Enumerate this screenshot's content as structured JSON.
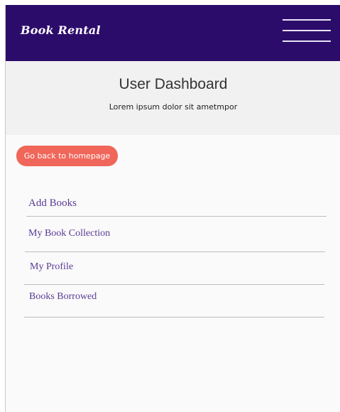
{
  "navbar": {
    "brand": "Book Rental",
    "menu_icon": "hamburger-menu-icon",
    "background_color": "#2c0c6b"
  },
  "hero": {
    "title": "User Dashboard",
    "subtitle": "Lorem ipsum dolor sit ametmpor"
  },
  "back_button": {
    "label": "Go back to homepage",
    "color": "#f0665a"
  },
  "menu": {
    "items": [
      {
        "label": "Add Books"
      },
      {
        "label": "My Book Collection"
      },
      {
        "label": "My Profile"
      },
      {
        "label": "Books Borrowed"
      }
    ],
    "link_color": "#5a3a96"
  }
}
